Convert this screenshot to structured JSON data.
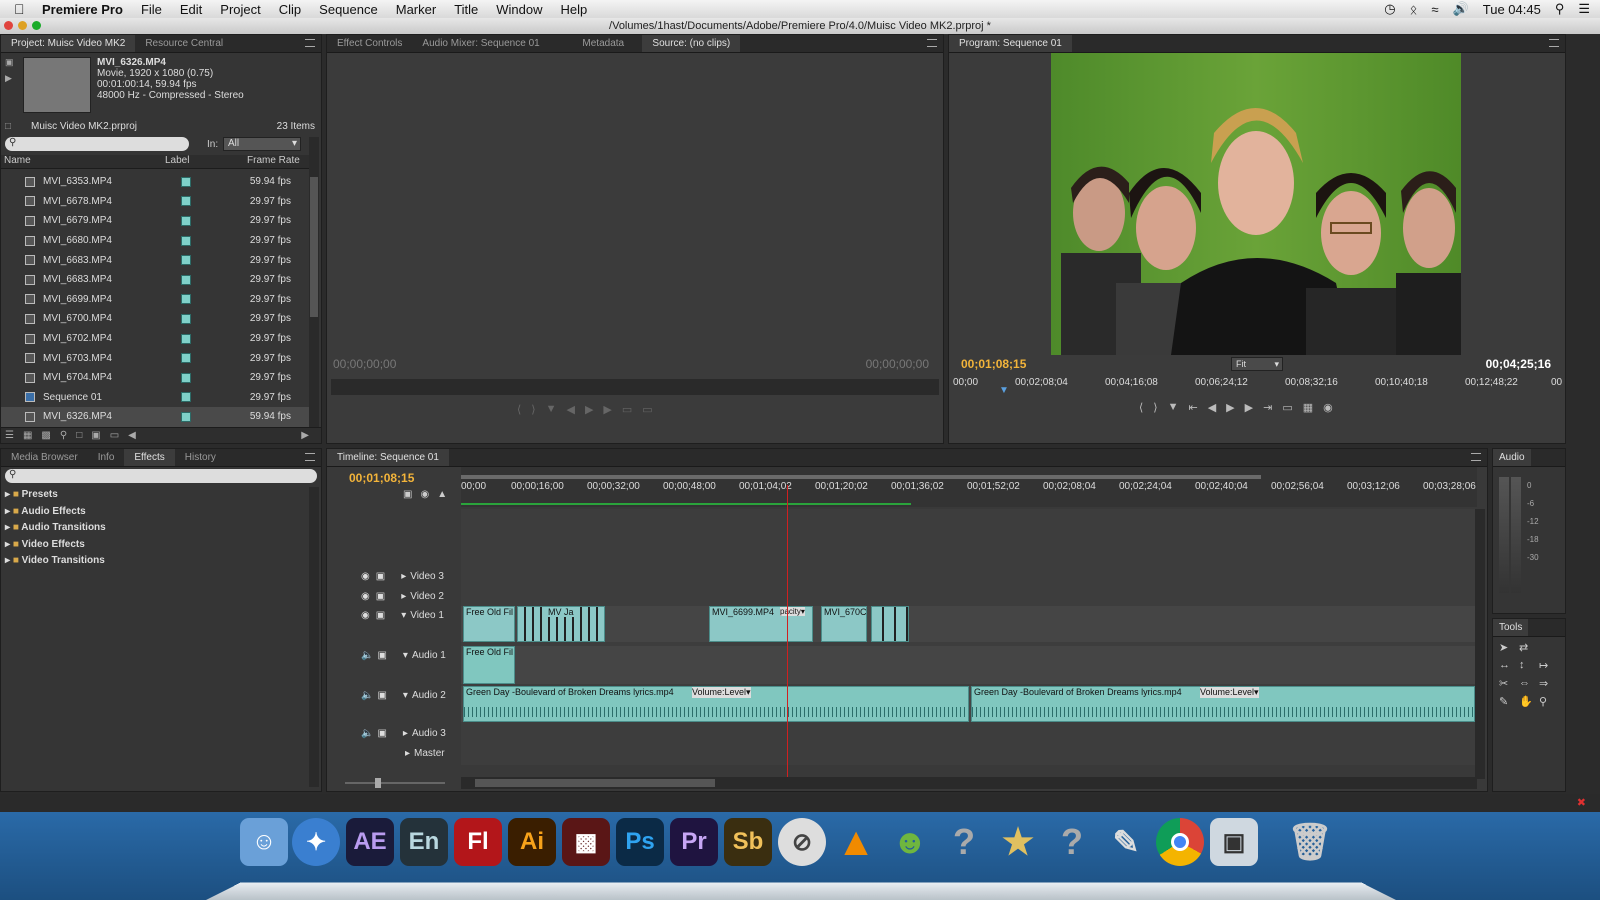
{
  "menubar": {
    "app": "Premiere Pro",
    "items": [
      "File",
      "Edit",
      "Project",
      "Clip",
      "Sequence",
      "Marker",
      "Title",
      "Window",
      "Help"
    ],
    "clock": "Tue 04:45"
  },
  "window": {
    "title": "/Volumes/1hast/Documents/Adobe/Premiere Pro/4.0/Muisc Video MK2.prproj *"
  },
  "project": {
    "tabs": [
      "Project: Muisc Video MK2",
      "Resource Central"
    ],
    "clip_name": "MVI_6326.MP4",
    "clip_type": "Movie, 1920 x 1080 (0.75)",
    "clip_duration": "00:01:00:14, 59.94 fps",
    "clip_audio": "48000 Hz - Compressed - Stereo",
    "project_file": "Muisc Video MK2.prproj",
    "item_count": "23 Items",
    "in_label": "In:",
    "in_value": "All",
    "col_name": "Name",
    "col_label": "Label",
    "col_rate": "Frame Rate",
    "items": [
      {
        "name": "MVI_6353.MP4",
        "rate": "59.94 fps"
      },
      {
        "name": "MVI_6678.MP4",
        "rate": "29.97 fps"
      },
      {
        "name": "MVI_6679.MP4",
        "rate": "29.97 fps"
      },
      {
        "name": "MVI_6680.MP4",
        "rate": "29.97 fps"
      },
      {
        "name": "MVI_6683.MP4",
        "rate": "29.97 fps"
      },
      {
        "name": "MVI_6683.MP4",
        "rate": "29.97 fps"
      },
      {
        "name": "MVI_6699.MP4",
        "rate": "29.97 fps"
      },
      {
        "name": "MVI_6700.MP4",
        "rate": "29.97 fps"
      },
      {
        "name": "MVI_6702.MP4",
        "rate": "29.97 fps"
      },
      {
        "name": "MVI_6703.MP4",
        "rate": "29.97 fps"
      },
      {
        "name": "MVI_6704.MP4",
        "rate": "29.97 fps"
      },
      {
        "name": "Sequence 01",
        "rate": "29.97 fps"
      },
      {
        "name": "MVI_6326.MP4",
        "rate": "59.94 fps"
      }
    ]
  },
  "source": {
    "tabs": [
      "Effect Controls",
      "Audio Mixer: Sequence 01",
      "Metadata",
      "Source: (no clips)"
    ],
    "tc_in": "00;00;00;00",
    "tc_out": "00;00;00;00"
  },
  "program": {
    "tab": "Program: Sequence 01",
    "tc_current": "00;01;08;15",
    "tc_total": "00;04;25;16",
    "fit": "Fit",
    "ruler": [
      "00;00",
      "00;02;08;04",
      "00;04;16;08",
      "00;06;24;12",
      "00;08;32;16",
      "00;10;40;18",
      "00;12;48;22",
      "00"
    ]
  },
  "effects": {
    "tabs": [
      "Media Browser",
      "Info",
      "Effects",
      "History"
    ],
    "folders": [
      "Presets",
      "Audio Effects",
      "Audio Transitions",
      "Video Effects",
      "Video Transitions"
    ]
  },
  "timeline": {
    "tab": "Timeline: Sequence 01",
    "tc": "00;01;08;15",
    "ruler": [
      "00;00",
      "00;00;16;00",
      "00;00;32;00",
      "00;00;48;00",
      "00;01;04;02",
      "00;01;20;02",
      "00;01;36;02",
      "00;01;52;02",
      "00;02;08;04",
      "00;02;24;04",
      "00;02;40;04",
      "00;02;56;04",
      "00;03;12;06",
      "00;03;28;06"
    ],
    "tracks": {
      "v3": "Video 3",
      "v2": "Video 2",
      "v1": "Video 1",
      "a1": "Audio 1",
      "a2": "Audio 2",
      "a3": "Audio 3",
      "master": "Master"
    },
    "clips": {
      "v1a": "Free Old Fil",
      "v1b": "MVI_6699.MP4",
      "v1b_fx": "pacity",
      "v1c": "MVI_670C",
      "v1c2": "MV",
      "v1c3": "Ja",
      "a1": "Free Old Fil",
      "a2a": "Green Day -Boulevard of Broken Dreams lyrics.mp4",
      "a2a_fx": "Volume:Level",
      "a2b": "Green Day -Boulevard of Broken Dreams lyrics.mp4",
      "a2b_fx": "Volume:Level"
    }
  },
  "audio_panel": {
    "tab": "Audio",
    "levels": [
      "0",
      "-6",
      "-12",
      "-18",
      "-30"
    ]
  },
  "tools": {
    "tab": "Tools"
  },
  "dock": {
    "items": [
      "Finder",
      "Safari",
      "AE",
      "En",
      "Fl",
      "Ai",
      "Film",
      "Ps",
      "Pr",
      "Sb",
      "NoSign",
      "VLC",
      "Monkey",
      "?",
      "iMovie",
      "?",
      "Script",
      "Chrome",
      "Preview",
      "Trash"
    ]
  }
}
